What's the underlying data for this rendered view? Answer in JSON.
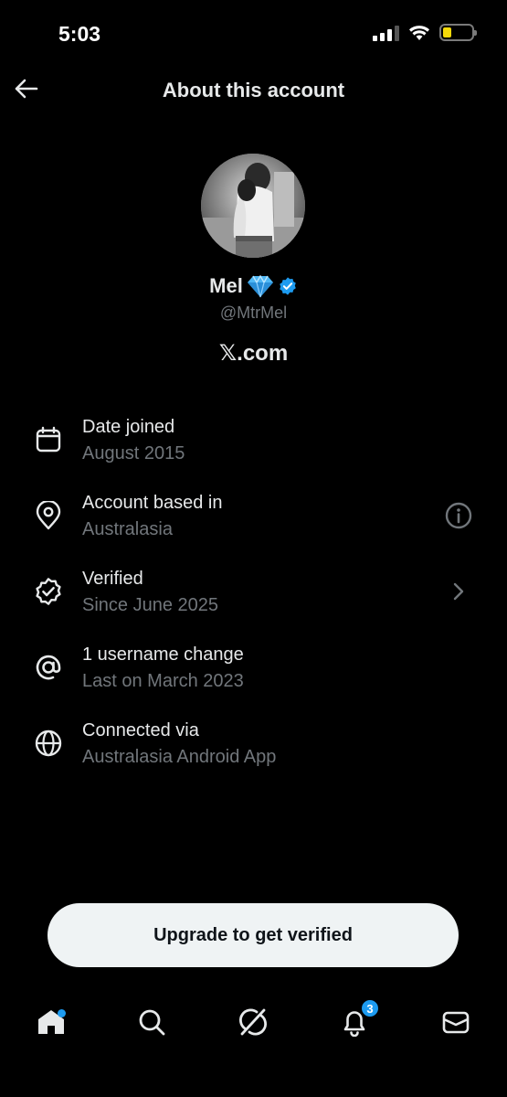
{
  "status_bar": {
    "time": "5:03"
  },
  "header": {
    "title": "About this account"
  },
  "profile": {
    "name": "Mel",
    "handle": "@MtrMel",
    "site": "𝕏.com"
  },
  "info": [
    {
      "icon": "calendar-icon",
      "title": "Date joined",
      "subtitle": "August 2015",
      "trailing": ""
    },
    {
      "icon": "location-pin-icon",
      "title": "Account based in",
      "subtitle": "Australasia",
      "trailing": "info-icon"
    },
    {
      "icon": "verified-badge-icon",
      "title": "Verified",
      "subtitle": "Since June 2025",
      "trailing": "chevron-right-icon"
    },
    {
      "icon": "at-icon",
      "title": "1 username change",
      "subtitle": "Last on March 2023",
      "trailing": ""
    },
    {
      "icon": "globe-icon",
      "title": "Connected via",
      "subtitle": "Australasia Android App",
      "trailing": ""
    }
  ],
  "cta": {
    "label": "Upgrade to get verified"
  },
  "tabbar": {
    "items": [
      "home-icon",
      "search-icon",
      "grok-icon",
      "bell-icon",
      "mail-icon"
    ],
    "notifications_count": "3"
  },
  "colors": {
    "accent": "#1d9bf0",
    "secondary_text": "#71767b",
    "background": "#000000",
    "cta_bg": "#eff3f4"
  }
}
